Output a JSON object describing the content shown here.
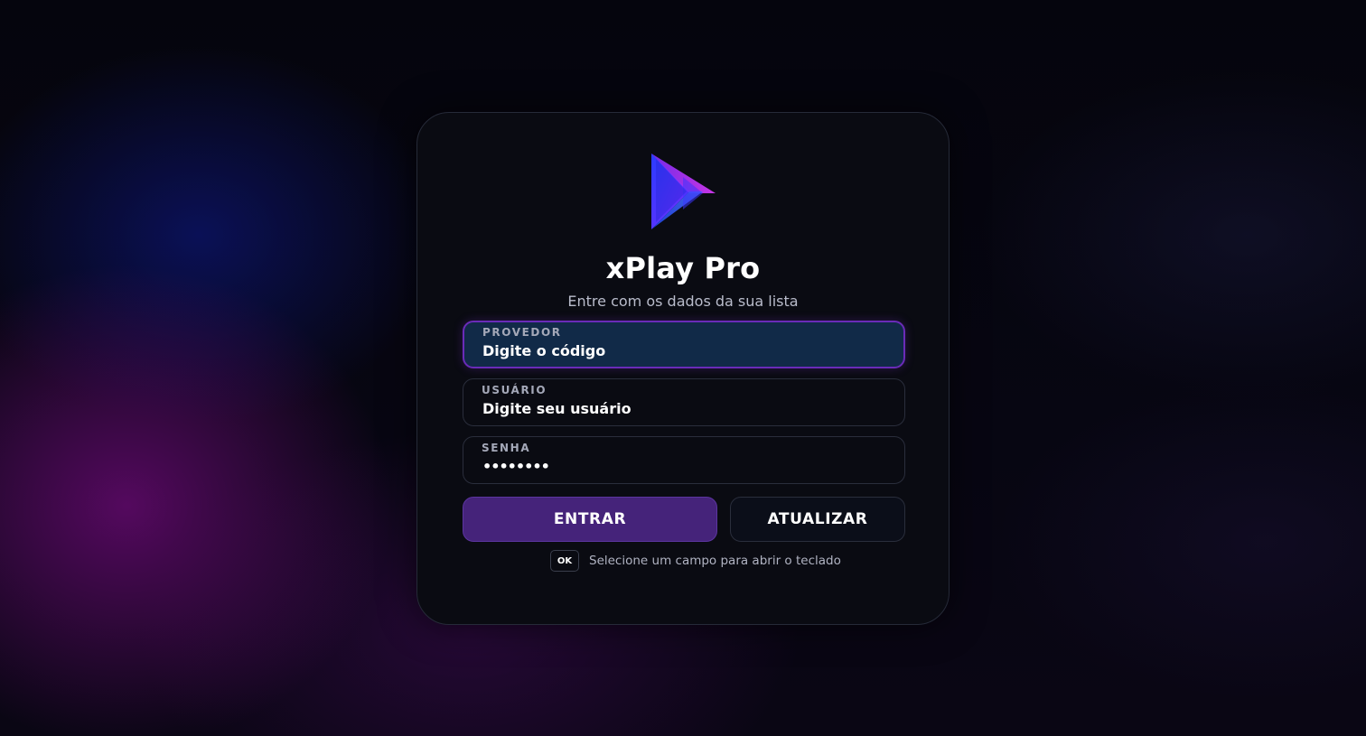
{
  "app": {
    "title": "xPlay Pro",
    "subtitle": "Entre com os dados da sua lista",
    "logo_icon": "play-arrow-logo-icon"
  },
  "form": {
    "provider": {
      "label": "PROVEDOR",
      "value": "Digite o código",
      "active": true
    },
    "user": {
      "label": "USUÁRIO",
      "value": "Digite seu usuário"
    },
    "password": {
      "label": "SENHA",
      "value": "••••••••"
    }
  },
  "buttons": {
    "enter": "ENTRAR",
    "refresh": "ATUALIZAR"
  },
  "hint": {
    "key": "OK",
    "text": "Selecione um campo para abrir o teclado"
  },
  "colors": {
    "accent": "#6a2bb8",
    "primary_button": "#45237a",
    "active_field_bg": "#112a48",
    "card_bg": "#0a0b12"
  }
}
